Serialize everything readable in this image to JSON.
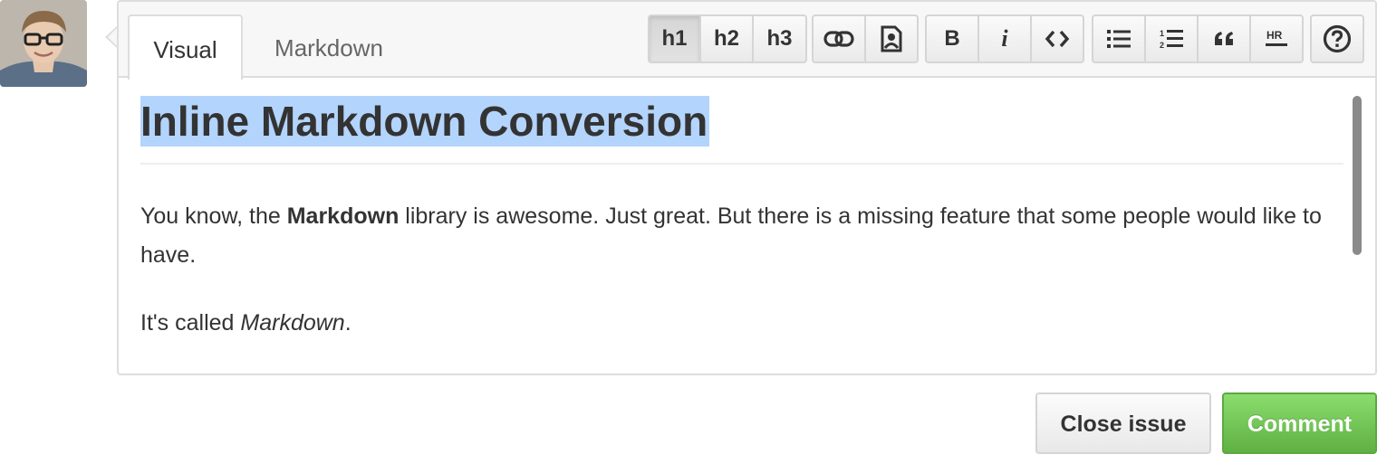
{
  "tabs": {
    "visual": "Visual",
    "markdown": "Markdown"
  },
  "toolbar": {
    "headings": [
      {
        "label": "h1",
        "active": true
      },
      {
        "label": "h2",
        "active": false
      },
      {
        "label": "h3",
        "active": false
      }
    ],
    "insert": [
      "link-icon",
      "image-icon"
    ],
    "format": [
      {
        "label": "B",
        "icon": "bold-icon"
      },
      {
        "label": "i",
        "icon": "italic-icon"
      },
      {
        "label": "<>",
        "icon": "code-icon"
      }
    ],
    "blocks": [
      "unordered-list-icon",
      "ordered-list-icon",
      "blockquote-icon",
      "horizontal-rule-icon"
    ],
    "help": "help-icon"
  },
  "editor": {
    "heading": "Inline Markdown Conversion",
    "p1_pre": "You know, the ",
    "p1_bold": "Markdown",
    "p1_post": " library is awesome. Just great. But there is a missing feature that some people would like to have.",
    "p2_pre": "It's called ",
    "p2_italic": "Markdown",
    "p2_post": "."
  },
  "actions": {
    "close": "Close issue",
    "comment": "Comment"
  },
  "colors": {
    "selection": "#b3d4fc",
    "comment_button": "#6cc644",
    "border": "#dddddd"
  }
}
